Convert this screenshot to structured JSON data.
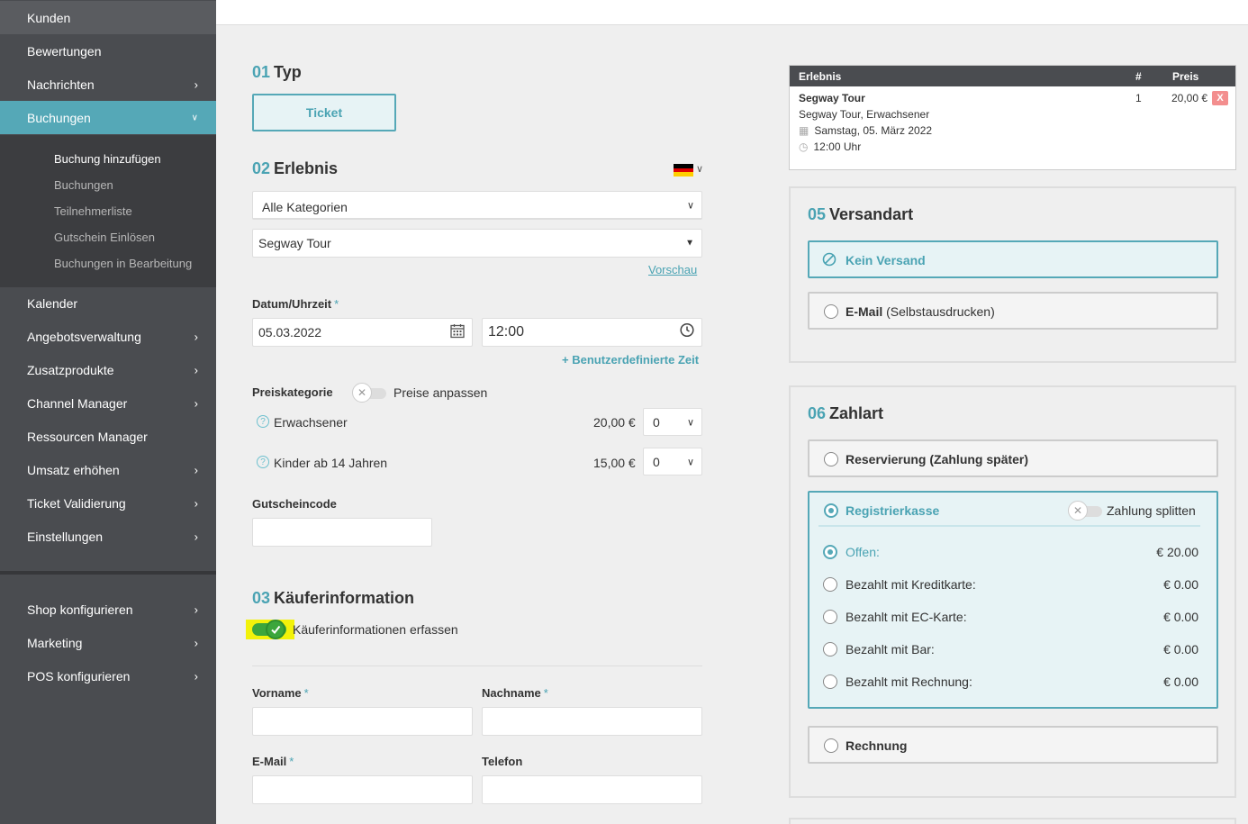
{
  "sidebar": {
    "items": [
      {
        "label": "Kunden"
      },
      {
        "label": "Bewertungen"
      },
      {
        "label": "Nachrichten"
      },
      {
        "label": "Buchungen"
      },
      {
        "label": "Kalender"
      },
      {
        "label": "Angebotsverwaltung"
      },
      {
        "label": "Zusatzprodukte"
      },
      {
        "label": "Channel Manager"
      },
      {
        "label": "Ressourcen Manager"
      },
      {
        "label": "Umsatz erhöhen"
      },
      {
        "label": "Ticket Validierung"
      },
      {
        "label": "Einstellungen"
      },
      {
        "label": "Shop konfigurieren"
      },
      {
        "label": "Marketing"
      },
      {
        "label": "POS konfigurieren"
      }
    ],
    "sub_items": [
      {
        "label": "Buchung hinzufügen"
      },
      {
        "label": "Buchungen"
      },
      {
        "label": "Teilnehmerliste"
      },
      {
        "label": "Gutschein Einlösen"
      },
      {
        "label": "Buchungen in Bearbeitung"
      }
    ]
  },
  "section1": {
    "num": "01",
    "title": "Typ",
    "ticket_label": "Ticket"
  },
  "section2": {
    "num": "02",
    "title": "Erlebnis",
    "category_value": "Alle Kategorien",
    "experience_value": "Segway Tour",
    "preview_link": "Vorschau",
    "date_label": "Datum/Uhrzeit",
    "required": "*",
    "date_value": "05.03.2022",
    "time_value": "12:00",
    "custom_time_link": "+ Benutzerdefinierte Zeit",
    "price_category_label": "Preiskategorie",
    "adjust_prices_label": "Preise anpassen",
    "prices": [
      {
        "name": "Erwachsener",
        "price": "20,00 €",
        "qty": "0"
      },
      {
        "name": "Kinder ab 14 Jahren",
        "price": "15,00 €",
        "qty": "0"
      }
    ],
    "voucher_label": "Gutscheincode",
    "voucher_value": ""
  },
  "section3": {
    "num": "03",
    "title": "Käuferinformation",
    "capture_label": "Käuferinformationen erfassen",
    "firstname_label": "Vorname",
    "lastname_label": "Nachname",
    "email_label": "E-Mail",
    "phone_label": "Telefon"
  },
  "cart": {
    "col_experience": "Erlebnis",
    "col_count": "#",
    "col_price": "Preis",
    "item_title": "Segway Tour",
    "item_subtitle": "Segway Tour, Erwachsener",
    "item_date": "Samstag, 05. März 2022",
    "item_time": "12:00 Uhr",
    "item_count": "1",
    "item_price": "20,00 €",
    "remove_label": "X"
  },
  "section5": {
    "num": "05",
    "title": "Versandart",
    "options": [
      {
        "label": "Kein Versand",
        "extra": ""
      },
      {
        "label": "E-Mail",
        "extra": "(Selbstausdrucken)"
      }
    ]
  },
  "section6": {
    "num": "06",
    "title": "Zahlart",
    "reservation_label": "Reservierung (Zahlung später)",
    "register_label": "Registrierkasse",
    "split_label": "Zahlung splitten",
    "payments": [
      {
        "label": "Offen:",
        "amount": "€ 20.00"
      },
      {
        "label": "Bezahlt mit Kreditkarte:",
        "amount": "€ 0.00"
      },
      {
        "label": "Bezahlt mit EC-Karte:",
        "amount": "€ 0.00"
      },
      {
        "label": "Bezahlt mit Bar:",
        "amount": "€ 0.00"
      },
      {
        "label": "Bezahlt mit Rechnung:",
        "amount": "€ 0.00"
      }
    ],
    "invoice_label": "Rechnung"
  },
  "colors": {
    "accent": "#55a8b7",
    "sidebar": "#4a4c50",
    "highlight": "#f2f20a",
    "toggle_on": "#3ca63c"
  }
}
